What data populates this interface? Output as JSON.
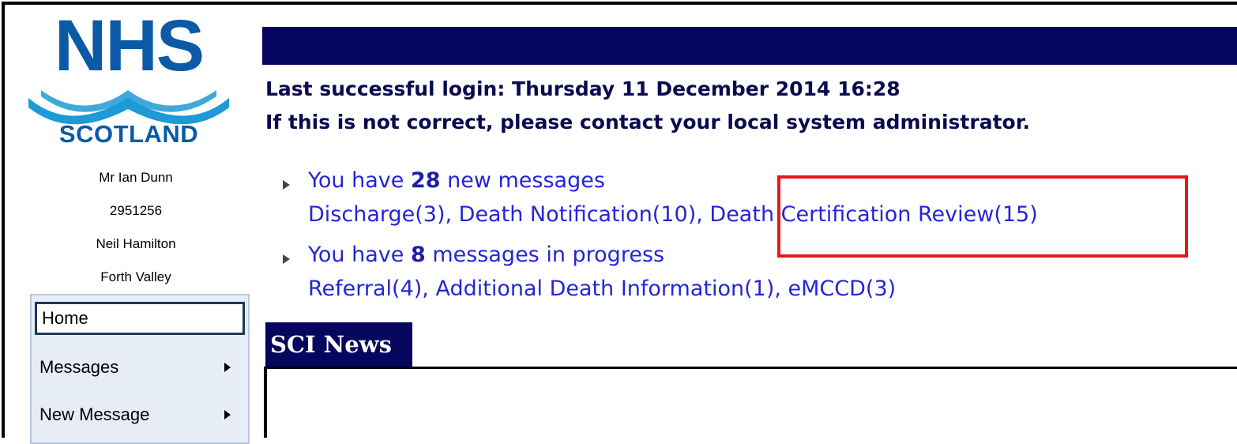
{
  "logo": {
    "nhs": "NHS",
    "scotland": "SCOTLAND",
    "colors": {
      "brand_blue": "#0c5aa6",
      "wave_blue": "#1e9ad6"
    }
  },
  "user": {
    "name": "Mr Ian Dunn",
    "id": "2951256",
    "practice": "Neil Hamilton",
    "region": "Forth Valley"
  },
  "nav": {
    "items": [
      {
        "label": "Home",
        "has_submenu": false,
        "selected": true
      },
      {
        "label": "Messages",
        "has_submenu": true
      },
      {
        "label": "New Message",
        "has_submenu": true
      }
    ]
  },
  "login": {
    "line1": "Last successful login: Thursday 11 December 2014 16:28",
    "line2": "If this is not correct, please contact your local system administrator."
  },
  "messages": {
    "new": {
      "prefix": "You have ",
      "count": "28",
      "suffix": " new messages",
      "links": [
        "Discharge(3), ",
        "Death Notification(10), ",
        "Death Certification Review(15)"
      ]
    },
    "in_progress": {
      "prefix": "You have ",
      "count": "8",
      "suffix": " messages in progress",
      "links": [
        "Referral(4), ",
        "Additional Death Information(1), ",
        "eMCCD(3)"
      ]
    }
  },
  "news": {
    "title": "SCI News"
  },
  "colors": {
    "header_bar": "#06065e",
    "link_blue": "#2525d8",
    "highlight_red": "#e8151c",
    "nav_bg": "#e7edf6"
  }
}
